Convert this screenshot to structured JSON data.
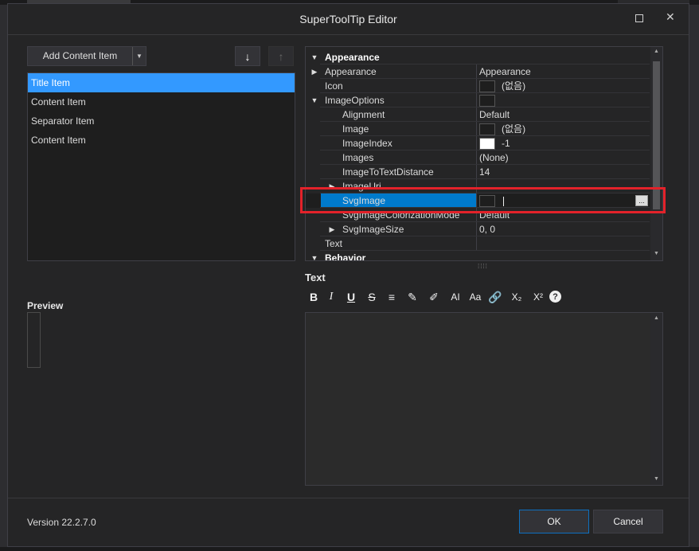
{
  "window": {
    "title": "SuperToolTip Editor"
  },
  "left_panel": {
    "add_button": "Add Content Item",
    "items": [
      {
        "label": "Title Item",
        "selected": true
      },
      {
        "label": "Content Item"
      },
      {
        "label": "Separator Item"
      },
      {
        "label": "Content Item"
      }
    ],
    "preview_label": "Preview"
  },
  "property_grid": {
    "rows": [
      {
        "kind": "category",
        "name": "Appearance",
        "expanded": true
      },
      {
        "name": "Appearance",
        "value": "Appearance",
        "expander": "collapsed"
      },
      {
        "name": "Icon",
        "value": "(없음)",
        "swatch": "dark"
      },
      {
        "name": "ImageOptions",
        "value": "",
        "swatch": "dark",
        "expander": "expanded"
      },
      {
        "name": "Alignment",
        "value": "Default",
        "indent": true
      },
      {
        "name": "Image",
        "value": "(없음)",
        "swatch": "dark",
        "indent": true
      },
      {
        "name": "ImageIndex",
        "value": "-1",
        "swatch": "white",
        "indent": true
      },
      {
        "name": "Images",
        "value": "(None)",
        "indent": true
      },
      {
        "name": "ImageToTextDistance",
        "value": "14",
        "indent": true
      },
      {
        "name": "ImageUri",
        "value": "",
        "indent": true,
        "expander": "collapsed"
      },
      {
        "name": "SvgImage",
        "value": "",
        "swatch": "dark",
        "indent": true,
        "selected": true,
        "editing": true
      },
      {
        "name": "SvgImageColorizationMode",
        "value": "Default",
        "indent": true
      },
      {
        "name": "SvgImageSize",
        "value": "0, 0",
        "indent": true,
        "expander": "collapsed"
      },
      {
        "name": "Text",
        "value": ""
      },
      {
        "kind": "category",
        "name": "Behavior",
        "expanded": true
      }
    ],
    "ellipsis": "..."
  },
  "text_section": {
    "label": "Text",
    "toolbar": [
      {
        "name": "bold-icon",
        "glyph": "B"
      },
      {
        "name": "italic-icon",
        "glyph": "I"
      },
      {
        "name": "underline-icon",
        "glyph": "U"
      },
      {
        "name": "strikethrough-icon",
        "glyph": "S"
      },
      {
        "name": "paragraph-icon",
        "glyph": "≡"
      },
      {
        "name": "color-pen-icon",
        "glyph": "✎"
      },
      {
        "name": "highlight-brush-icon",
        "glyph": "✐"
      },
      {
        "name": "font-size-icon",
        "glyph": "AI"
      },
      {
        "name": "font-case-icon",
        "glyph": "Aa"
      },
      {
        "name": "link-icon",
        "glyph": "🔗"
      },
      {
        "name": "subscript-icon",
        "glyph": "X₂"
      },
      {
        "name": "superscript-icon",
        "glyph": "X²"
      },
      {
        "name": "help-icon",
        "glyph": "?"
      }
    ]
  },
  "footer": {
    "version": "Version 22.2.7.0",
    "ok": "OK",
    "cancel": "Cancel"
  },
  "colors": {
    "accent": "#007acc",
    "list_selection": "#3399ff",
    "highlight_box": "#e3222a"
  }
}
